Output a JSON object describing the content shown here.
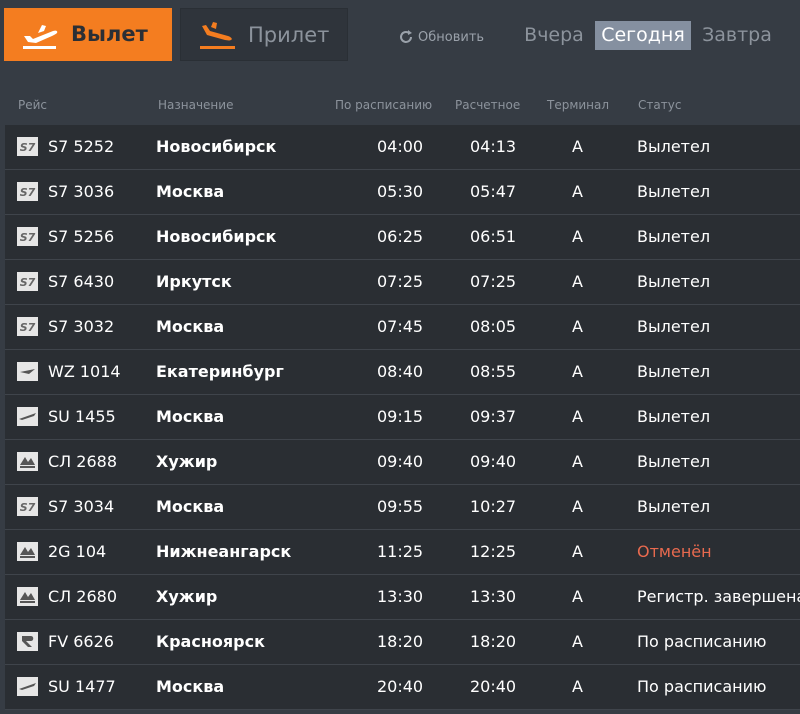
{
  "tabs": {
    "departure_label": "Вылет",
    "arrival_label": "Прилет",
    "refresh_label": "Обновить"
  },
  "days": {
    "yesterday": "Вчера",
    "today": "Сегодня",
    "tomorrow": "Завтра",
    "selected": "today"
  },
  "columns": {
    "flight": "Рейс",
    "destination": "Назначение",
    "scheduled": "По расписанию",
    "estimated": "Расчетное",
    "terminal": "Терминал",
    "status": "Статус"
  },
  "colors": {
    "accent": "#f47d20",
    "cancelled": "#e86a4f",
    "selected_day": "#8590a0"
  },
  "flights": [
    {
      "airline_icon": "s7-logo-icon",
      "flight": "S7 5252",
      "destination": "Новосибирск",
      "scheduled": "04:00",
      "estimated": "04:13",
      "terminal": "A",
      "status": "Вылетел",
      "cancelled": false
    },
    {
      "airline_icon": "s7-logo-icon",
      "flight": "S7 3036",
      "destination": "Москва",
      "scheduled": "05:30",
      "estimated": "05:47",
      "terminal": "A",
      "status": "Вылетел",
      "cancelled": false
    },
    {
      "airline_icon": "s7-logo-icon",
      "flight": "S7 5256",
      "destination": "Новосибирск",
      "scheduled": "06:25",
      "estimated": "06:51",
      "terminal": "A",
      "status": "Вылетел",
      "cancelled": false
    },
    {
      "airline_icon": "s7-logo-icon",
      "flight": "S7 6430",
      "destination": "Иркутск",
      "scheduled": "07:25",
      "estimated": "07:25",
      "terminal": "A",
      "status": "Вылетел",
      "cancelled": false
    },
    {
      "airline_icon": "s7-logo-icon",
      "flight": "S7 3032",
      "destination": "Москва",
      "scheduled": "07:45",
      "estimated": "08:05",
      "terminal": "A",
      "status": "Вылетел",
      "cancelled": false
    },
    {
      "airline_icon": "red-wings-logo-icon",
      "flight": "WZ 1014",
      "destination": "Екатеринбург",
      "scheduled": "08:40",
      "estimated": "08:55",
      "terminal": "A",
      "status": "Вылетел",
      "cancelled": false
    },
    {
      "airline_icon": "aeroflot-logo-icon",
      "flight": "SU 1455",
      "destination": "Москва",
      "scheduled": "09:15",
      "estimated": "09:37",
      "terminal": "A",
      "status": "Вылетел",
      "cancelled": false
    },
    {
      "airline_icon": "angara-logo-icon",
      "flight": "СЛ 2688",
      "destination": "Хужир",
      "scheduled": "09:40",
      "estimated": "09:40",
      "terminal": "A",
      "status": "Вылетел",
      "cancelled": false
    },
    {
      "airline_icon": "s7-logo-icon",
      "flight": "S7 3034",
      "destination": "Москва",
      "scheduled": "09:55",
      "estimated": "10:27",
      "terminal": "A",
      "status": "Вылетел",
      "cancelled": false
    },
    {
      "airline_icon": "angara-logo-icon",
      "flight": "2G 104",
      "destination": "Нижнеангарск",
      "scheduled": "11:25",
      "estimated": "12:25",
      "terminal": "A",
      "status": "Отменён",
      "cancelled": true
    },
    {
      "airline_icon": "angara-logo-icon",
      "flight": "СЛ 2680",
      "destination": "Хужир",
      "scheduled": "13:30",
      "estimated": "13:30",
      "terminal": "A",
      "status": "Регистр. завершена",
      "cancelled": false
    },
    {
      "airline_icon": "rossiya-logo-icon",
      "flight": "FV 6626",
      "destination": "Красноярск",
      "scheduled": "18:20",
      "estimated": "18:20",
      "terminal": "A",
      "status": "По расписанию",
      "cancelled": false
    },
    {
      "airline_icon": "aeroflot-logo-icon",
      "flight": "SU 1477",
      "destination": "Москва",
      "scheduled": "20:40",
      "estimated": "20:40",
      "terminal": "A",
      "status": "По расписанию",
      "cancelled": false
    }
  ]
}
